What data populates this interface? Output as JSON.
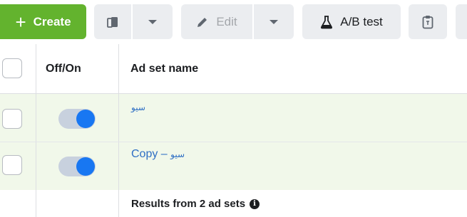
{
  "toolbar": {
    "create_label": "Create",
    "edit_label": "Edit",
    "ab_test_label": "A/B test",
    "icons": {
      "create": "plus-icon",
      "duplicate": "duplicate-icon",
      "duplicate_dropdown": "caret-down-icon",
      "edit": "pencil-icon",
      "edit_dropdown": "caret-down-icon",
      "ab_test": "flask-icon",
      "clipboard": "clipboard-icon"
    }
  },
  "table": {
    "headers": {
      "toggle": "Off/On",
      "name": "Ad set name"
    },
    "rows": [
      {
        "name": "سيو",
        "enabled": true
      },
      {
        "name_prefix": "Copy – ",
        "name": "سيو",
        "enabled": true
      }
    ],
    "footer": {
      "summary": "Results from 2 ad sets",
      "info_icon": "info-icon"
    }
  },
  "colors": {
    "create": "#63b32e",
    "toggle_knob": "#1877f2",
    "row_highlight": "#f1f8ea",
    "link": "#2f6fc4"
  }
}
